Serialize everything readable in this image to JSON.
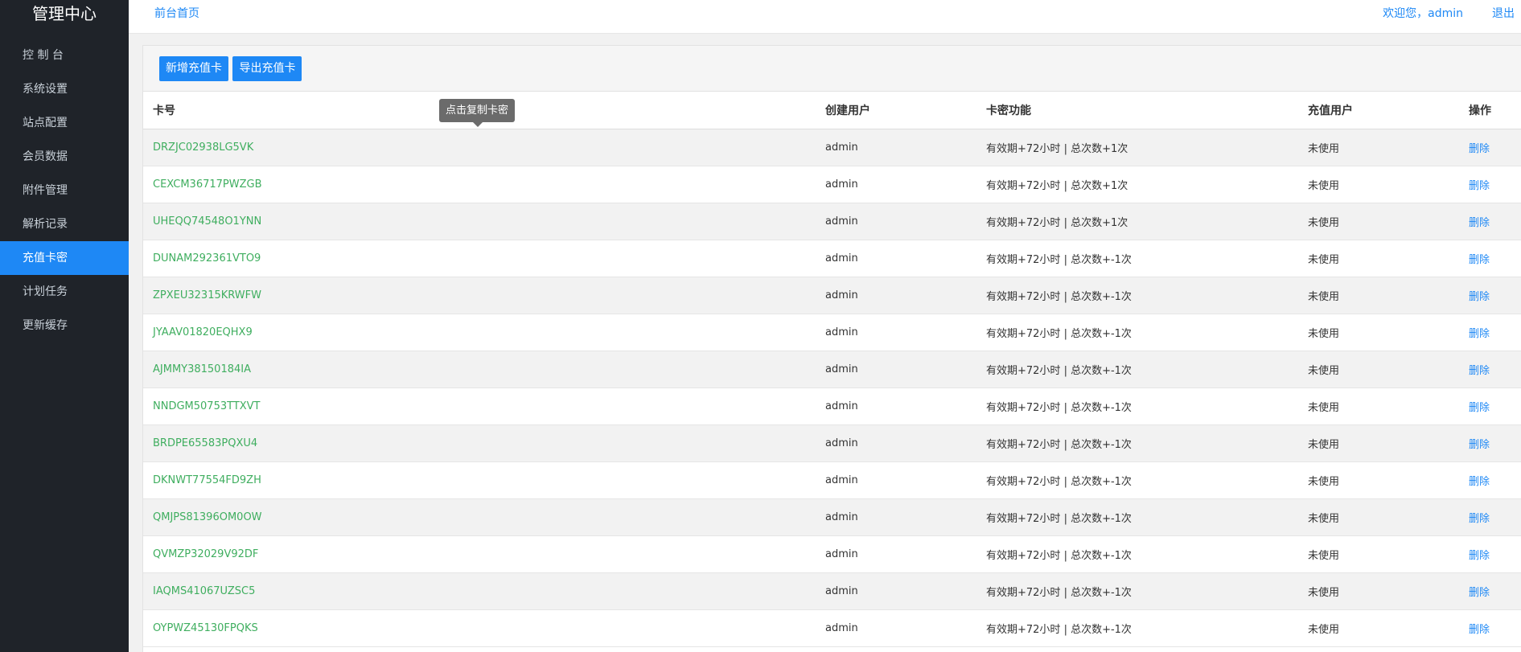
{
  "sidebar": {
    "brand": "管理中心",
    "items": [
      {
        "label": "控 制 台"
      },
      {
        "label": "系统设置"
      },
      {
        "label": "站点配置"
      },
      {
        "label": "会员数据"
      },
      {
        "label": "附件管理"
      },
      {
        "label": "解析记录"
      },
      {
        "label": "充值卡密",
        "active": true
      },
      {
        "label": "计划任务"
      },
      {
        "label": "更新缓存"
      }
    ]
  },
  "header": {
    "home_link": "前台首页",
    "welcome": "欢迎您，admin",
    "logout": "退出"
  },
  "toolbar": {
    "add_card_label": "新增充值卡",
    "export_card_label": "导出充值卡"
  },
  "tooltip": {
    "text": "点击复制卡密"
  },
  "table": {
    "headers": [
      "卡号",
      "创建用户",
      "卡密功能",
      "充值用户",
      "操作"
    ],
    "rows": [
      {
        "card": "DRZJC02938LG5VK",
        "creator": "admin",
        "function": "有效期+72小时 | 总次数+1次",
        "recharge_user": "未使用",
        "action": "删除"
      },
      {
        "card": "CEXCM36717PWZGB",
        "creator": "admin",
        "function": "有效期+72小时 | 总次数+1次",
        "recharge_user": "未使用",
        "action": "删除"
      },
      {
        "card": "UHEQQ74548O1YNN",
        "creator": "admin",
        "function": "有效期+72小时 | 总次数+1次",
        "recharge_user": "未使用",
        "action": "删除"
      },
      {
        "card": "DUNAM292361VTO9",
        "creator": "admin",
        "function": "有效期+72小时 | 总次数+-1次",
        "recharge_user": "未使用",
        "action": "删除"
      },
      {
        "card": "ZPXEU32315KRWFW",
        "creator": "admin",
        "function": "有效期+72小时 | 总次数+-1次",
        "recharge_user": "未使用",
        "action": "删除"
      },
      {
        "card": "JYAAV01820EQHX9",
        "creator": "admin",
        "function": "有效期+72小时 | 总次数+-1次",
        "recharge_user": "未使用",
        "action": "删除"
      },
      {
        "card": "AJMMY38150184IA",
        "creator": "admin",
        "function": "有效期+72小时 | 总次数+-1次",
        "recharge_user": "未使用",
        "action": "删除"
      },
      {
        "card": "NNDGM50753TTXVT",
        "creator": "admin",
        "function": "有效期+72小时 | 总次数+-1次",
        "recharge_user": "未使用",
        "action": "删除"
      },
      {
        "card": "BRDPE65583PQXU4",
        "creator": "admin",
        "function": "有效期+72小时 | 总次数+-1次",
        "recharge_user": "未使用",
        "action": "删除"
      },
      {
        "card": "DKNWT77554FD9ZH",
        "creator": "admin",
        "function": "有效期+72小时 | 总次数+-1次",
        "recharge_user": "未使用",
        "action": "删除"
      },
      {
        "card": "QMJPS81396OM0OW",
        "creator": "admin",
        "function": "有效期+72小时 | 总次数+-1次",
        "recharge_user": "未使用",
        "action": "删除"
      },
      {
        "card": "QVMZP32029V92DF",
        "creator": "admin",
        "function": "有效期+72小时 | 总次数+-1次",
        "recharge_user": "未使用",
        "action": "删除"
      },
      {
        "card": "IAQMS41067UZSC5",
        "creator": "admin",
        "function": "有效期+72小时 | 总次数+-1次",
        "recharge_user": "未使用",
        "action": "删除"
      },
      {
        "card": "OYPWZ45130FPQKS",
        "creator": "admin",
        "function": "有效期+72小时 | 总次数+-1次",
        "recharge_user": "未使用",
        "action": "删除"
      }
    ]
  },
  "colors": {
    "sidebar_bg": "#1f2329",
    "accent": "#1e88f5",
    "card_text": "#3fae5f"
  }
}
